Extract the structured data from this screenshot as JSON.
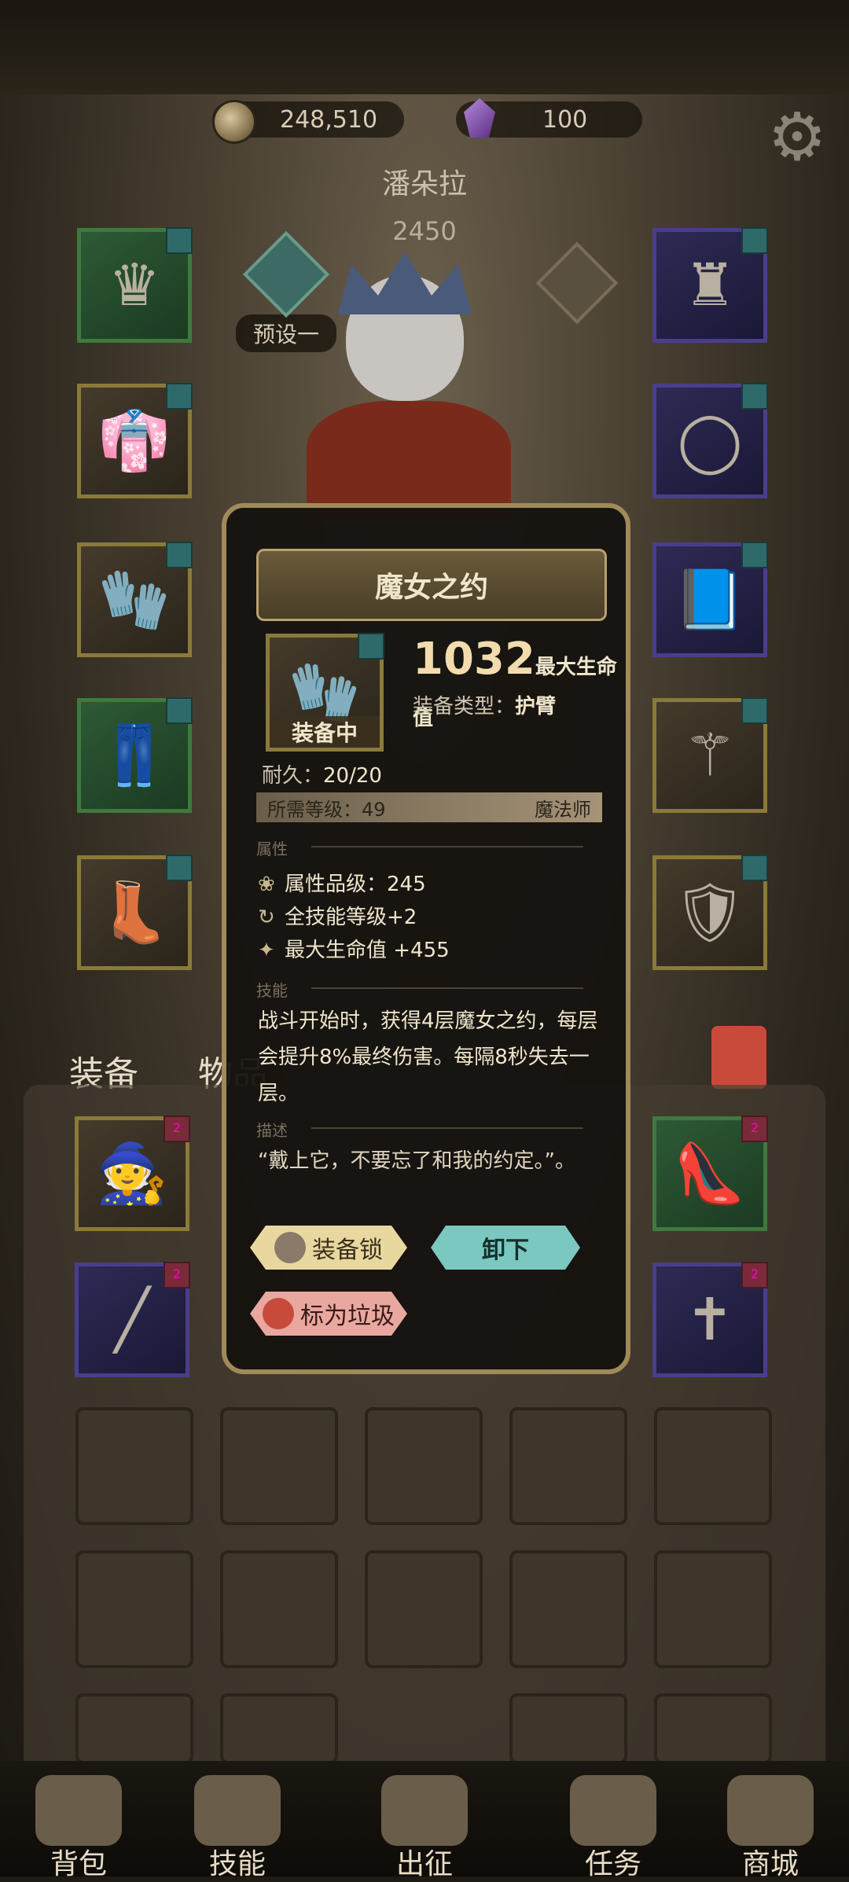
{
  "currency": {
    "gold": "248,510",
    "gems": "100"
  },
  "character": {
    "name": "潘朵拉",
    "power": "2450",
    "preset_label": "预设一"
  },
  "tabs": {
    "equipment": "装备",
    "items": "物品"
  },
  "left_slots": [
    "helmet-icon",
    "robe-icon",
    "bracer-icon",
    "pants-icon",
    "boots-icon"
  ],
  "right_slots": [
    "cape-icon",
    "ring-icon",
    "book-icon",
    "staff-icon",
    "shield-icon"
  ],
  "bag_items": [
    {
      "icon": "hood-icon",
      "badge": "2"
    },
    {
      "icon": "heels-icon",
      "badge": "2"
    },
    {
      "icon": "spear-icon",
      "badge": "2"
    },
    {
      "icon": "cross-necklace-icon",
      "badge": "2"
    }
  ],
  "popup": {
    "title": "魔女之约",
    "value": "1032",
    "value_label": "最大生命值",
    "type_label": "装备类型：",
    "type_value": "护臂",
    "equipped": "装备中",
    "durability_label": "耐久：",
    "durability_value": "20/20",
    "req_level": "所需等级：49",
    "req_class": "魔法师",
    "section_attr": "属性",
    "attr_quality": "属性品级：245",
    "attr_skill": "全技能等级+2",
    "attr_hp": "最大生命值 +455",
    "section_skill": "技能",
    "skill_text": "战斗开始时，获得4层魔女之约，每层会提升8%最终伤害。每隔8秒失去一层。",
    "section_desc": "描述",
    "desc_text": "“戴上它，不要忘了和我的约定。”。",
    "btn_lock": "装备锁",
    "btn_unequip": "卸下",
    "btn_trash": "标为垃圾"
  },
  "nav": [
    "背包",
    "技能",
    "出征",
    "任务",
    "商城"
  ]
}
